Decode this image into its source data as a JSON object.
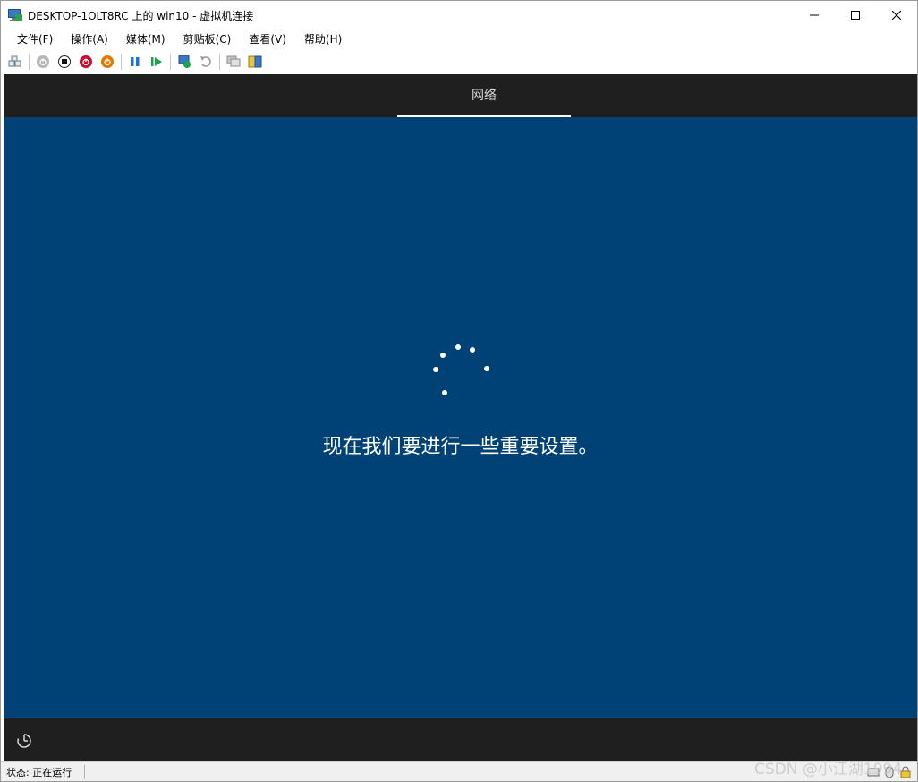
{
  "window": {
    "title": "DESKTOP-1OLT8RC 上的 win10 - 虚拟机连接"
  },
  "menu": [
    {
      "label": "文件(F)"
    },
    {
      "label": "操作(A)"
    },
    {
      "label": "媒体(M)"
    },
    {
      "label": "剪贴板(C)"
    },
    {
      "label": "查看(V)"
    },
    {
      "label": "帮助(H)"
    }
  ],
  "toolbar": {
    "icons": [
      "ctrl-alt-del-icon",
      "start-icon",
      "turn-off-icon",
      "shutdown-icon",
      "save-icon",
      "pause-icon",
      "resume-icon",
      "checkpoint-icon",
      "revert-icon",
      "enhanced-session-icon",
      "share-icon"
    ]
  },
  "vm": {
    "tab_label": "网络",
    "message": "现在我们要进行一些重要设置。"
  },
  "status": {
    "text": "状态: 正在运行"
  },
  "watermark": "CSDN @小江湖1994",
  "colors": {
    "vm_background": "#004275",
    "vm_bars": "#1f1f1f",
    "accent_red": "#c8102e",
    "accent_orange": "#e07b00",
    "accent_blue": "#1a73d9",
    "accent_green": "#1aa34a"
  }
}
